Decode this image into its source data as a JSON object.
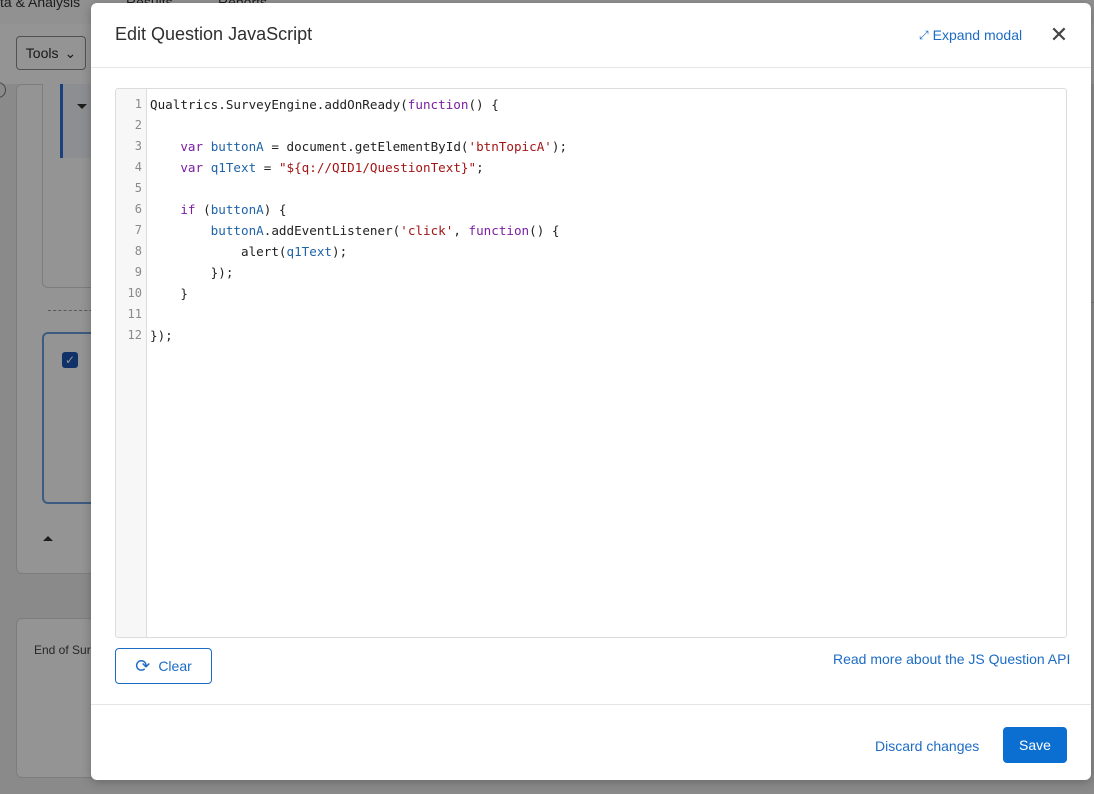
{
  "background": {
    "tabs": [
      "ta & Analysis",
      "Results",
      "Reports"
    ],
    "tools_label": "Tools",
    "end_of_survey_label": "End of Surv"
  },
  "modal": {
    "title": "Edit Question JavaScript",
    "expand_label": "Expand modal",
    "code_lines": [
      {
        "n": "1",
        "html": "Qualtrics.SurveyEngine.addOnReady(<span class=\"kw\">function</span>() {"
      },
      {
        "n": "2",
        "html": ""
      },
      {
        "n": "3",
        "html": "    <span class=\"kw\">var</span> <span class=\"var\">buttonA</span> = document.getElementById(<span class=\"str\">'btnTopicA'</span>);"
      },
      {
        "n": "4",
        "html": "    <span class=\"kw\">var</span> <span class=\"var\">q1Text</span> = <span class=\"str\">\"${q://QID1/QuestionText}\"</span>;"
      },
      {
        "n": "5",
        "html": ""
      },
      {
        "n": "6",
        "html": "    <span class=\"kw\">if</span> (<span class=\"var\">buttonA</span>) {"
      },
      {
        "n": "7",
        "html": "        <span class=\"var\">buttonA</span>.addEventListener(<span class=\"str\">'click'</span>, <span class=\"kw\">function</span>() {"
      },
      {
        "n": "8",
        "html": "            alert(<span class=\"var\">q1Text</span>);"
      },
      {
        "n": "9",
        "html": "        });"
      },
      {
        "n": "10",
        "html": "    }"
      },
      {
        "n": "11",
        "html": ""
      },
      {
        "n": "12",
        "html": "});"
      }
    ],
    "clear_label": "Clear",
    "api_link": "Read more about the JS Question API",
    "discard_label": "Discard changes",
    "save_label": "Save"
  },
  "colors": {
    "accent": "#1d6cc4",
    "save_bg": "#0b6ed1",
    "keyword": "#7a1fa2",
    "string": "#a31515",
    "variable": "#1f63a8"
  },
  "icons": {
    "expand": "expand-icon",
    "close": "close-icon",
    "clear": "refresh-icon"
  }
}
